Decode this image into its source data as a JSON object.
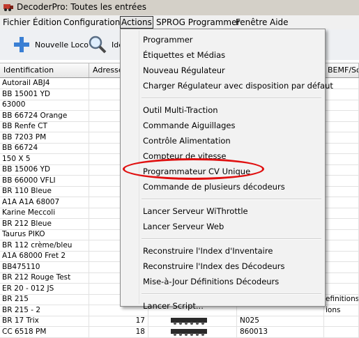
{
  "window": {
    "title": "DecoderPro: Toutes les entrées"
  },
  "menubar": [
    "Fichier",
    "Édition",
    "Configuration",
    "Actions",
    "SPROG Programmer",
    "Fenêtre",
    "Aide"
  ],
  "toolbar": {
    "new_loco": "Nouvelle Loco",
    "identify": "Ide"
  },
  "table": {
    "headers": [
      "Identification",
      "Adresse",
      "",
      "",
      "BEMF/Sou"
    ],
    "rows": [
      {
        "id": "Autorail ABJ4",
        "addr": "",
        "dec": "",
        "ext": ""
      },
      {
        "id": "BB 15001 YD",
        "addr": "",
        "dec": "",
        "ext": ""
      },
      {
        "id": "63000",
        "addr": "",
        "dec": "",
        "ext": ""
      },
      {
        "id": "BB 66724 Orange",
        "addr": "",
        "dec": "",
        "ext": ""
      },
      {
        "id": "BB Renfe CT",
        "addr": "",
        "dec": "",
        "ext": ""
      },
      {
        "id": "BB 7203 PM",
        "addr": "",
        "dec": "",
        "ext": ""
      },
      {
        "id": "BB 66724",
        "addr": "",
        "dec": "",
        "ext": ""
      },
      {
        "id": "150 X 5",
        "addr": "",
        "dec": "",
        "ext": ""
      },
      {
        "id": "BB 15006 YD",
        "addr": "",
        "dec": "",
        "ext": ""
      },
      {
        "id": "BB 66000 VFLI",
        "addr": "",
        "dec": "",
        "ext": ""
      },
      {
        "id": "BR 110 Bleue",
        "addr": "",
        "dec": "",
        "ext": ""
      },
      {
        "id": "A1A A1A 68007",
        "addr": "",
        "dec": "",
        "ext": ""
      },
      {
        "id": "Karine Meccoli",
        "addr": "",
        "dec": "",
        "ext": ""
      },
      {
        "id": "BR 212 Bleue",
        "addr": "",
        "dec": "",
        "ext": ""
      },
      {
        "id": "Taurus PIKO",
        "addr": "",
        "dec": "",
        "ext": ""
      },
      {
        "id": "BR 112 crème/bleu",
        "addr": "",
        "dec": "",
        "ext": ""
      },
      {
        "id": "A1A 68000 Fret 2",
        "addr": "",
        "dec": "",
        "ext": ""
      },
      {
        "id": "BB475110",
        "addr": "",
        "dec": "",
        "ext": ""
      },
      {
        "id": "BR 212 Rouge Test",
        "addr": "",
        "dec": "",
        "ext": ""
      },
      {
        "id": "ER 20 - 012 JS",
        "addr": "",
        "dec": "",
        "ext": ""
      },
      {
        "id": "BR 215",
        "addr": "",
        "dec": "",
        "ext": "efinitions"
      },
      {
        "id": "BR 215 - 2",
        "addr": "",
        "dec": "",
        "ext": "ions"
      },
      {
        "id": "BR 17 Trix",
        "addr": "17",
        "dec": "N025",
        "ext": ""
      },
      {
        "id": "CC 6518 PM",
        "addr": "18",
        "dec": "860013",
        "ext": ""
      }
    ]
  },
  "actions_menu": {
    "groups": [
      [
        "Programmer",
        "Étiquettes et Médias",
        "Nouveau Régulateur",
        "Charger Régulateur avec disposition par défaut"
      ],
      [
        "Outil Multi-Traction",
        "Commande Aiguillages",
        "Contrôle Alimentation",
        "Compteur de vitesse",
        "Programmateur CV Unique",
        "Commande de plusieurs décodeurs"
      ],
      [
        "Lancer Serveur WiThrottle",
        "Lancer Serveur Web"
      ],
      [
        "Reconstruire l'Index d'Inventaire",
        "Reconstruire l'Index des Décodeurs",
        "Mise-à-Jour Définitions Décodeurs"
      ],
      [
        "Lancer Script..."
      ]
    ],
    "highlighted": "Programmateur CV Unique",
    "highlight_color": "#e01010"
  }
}
